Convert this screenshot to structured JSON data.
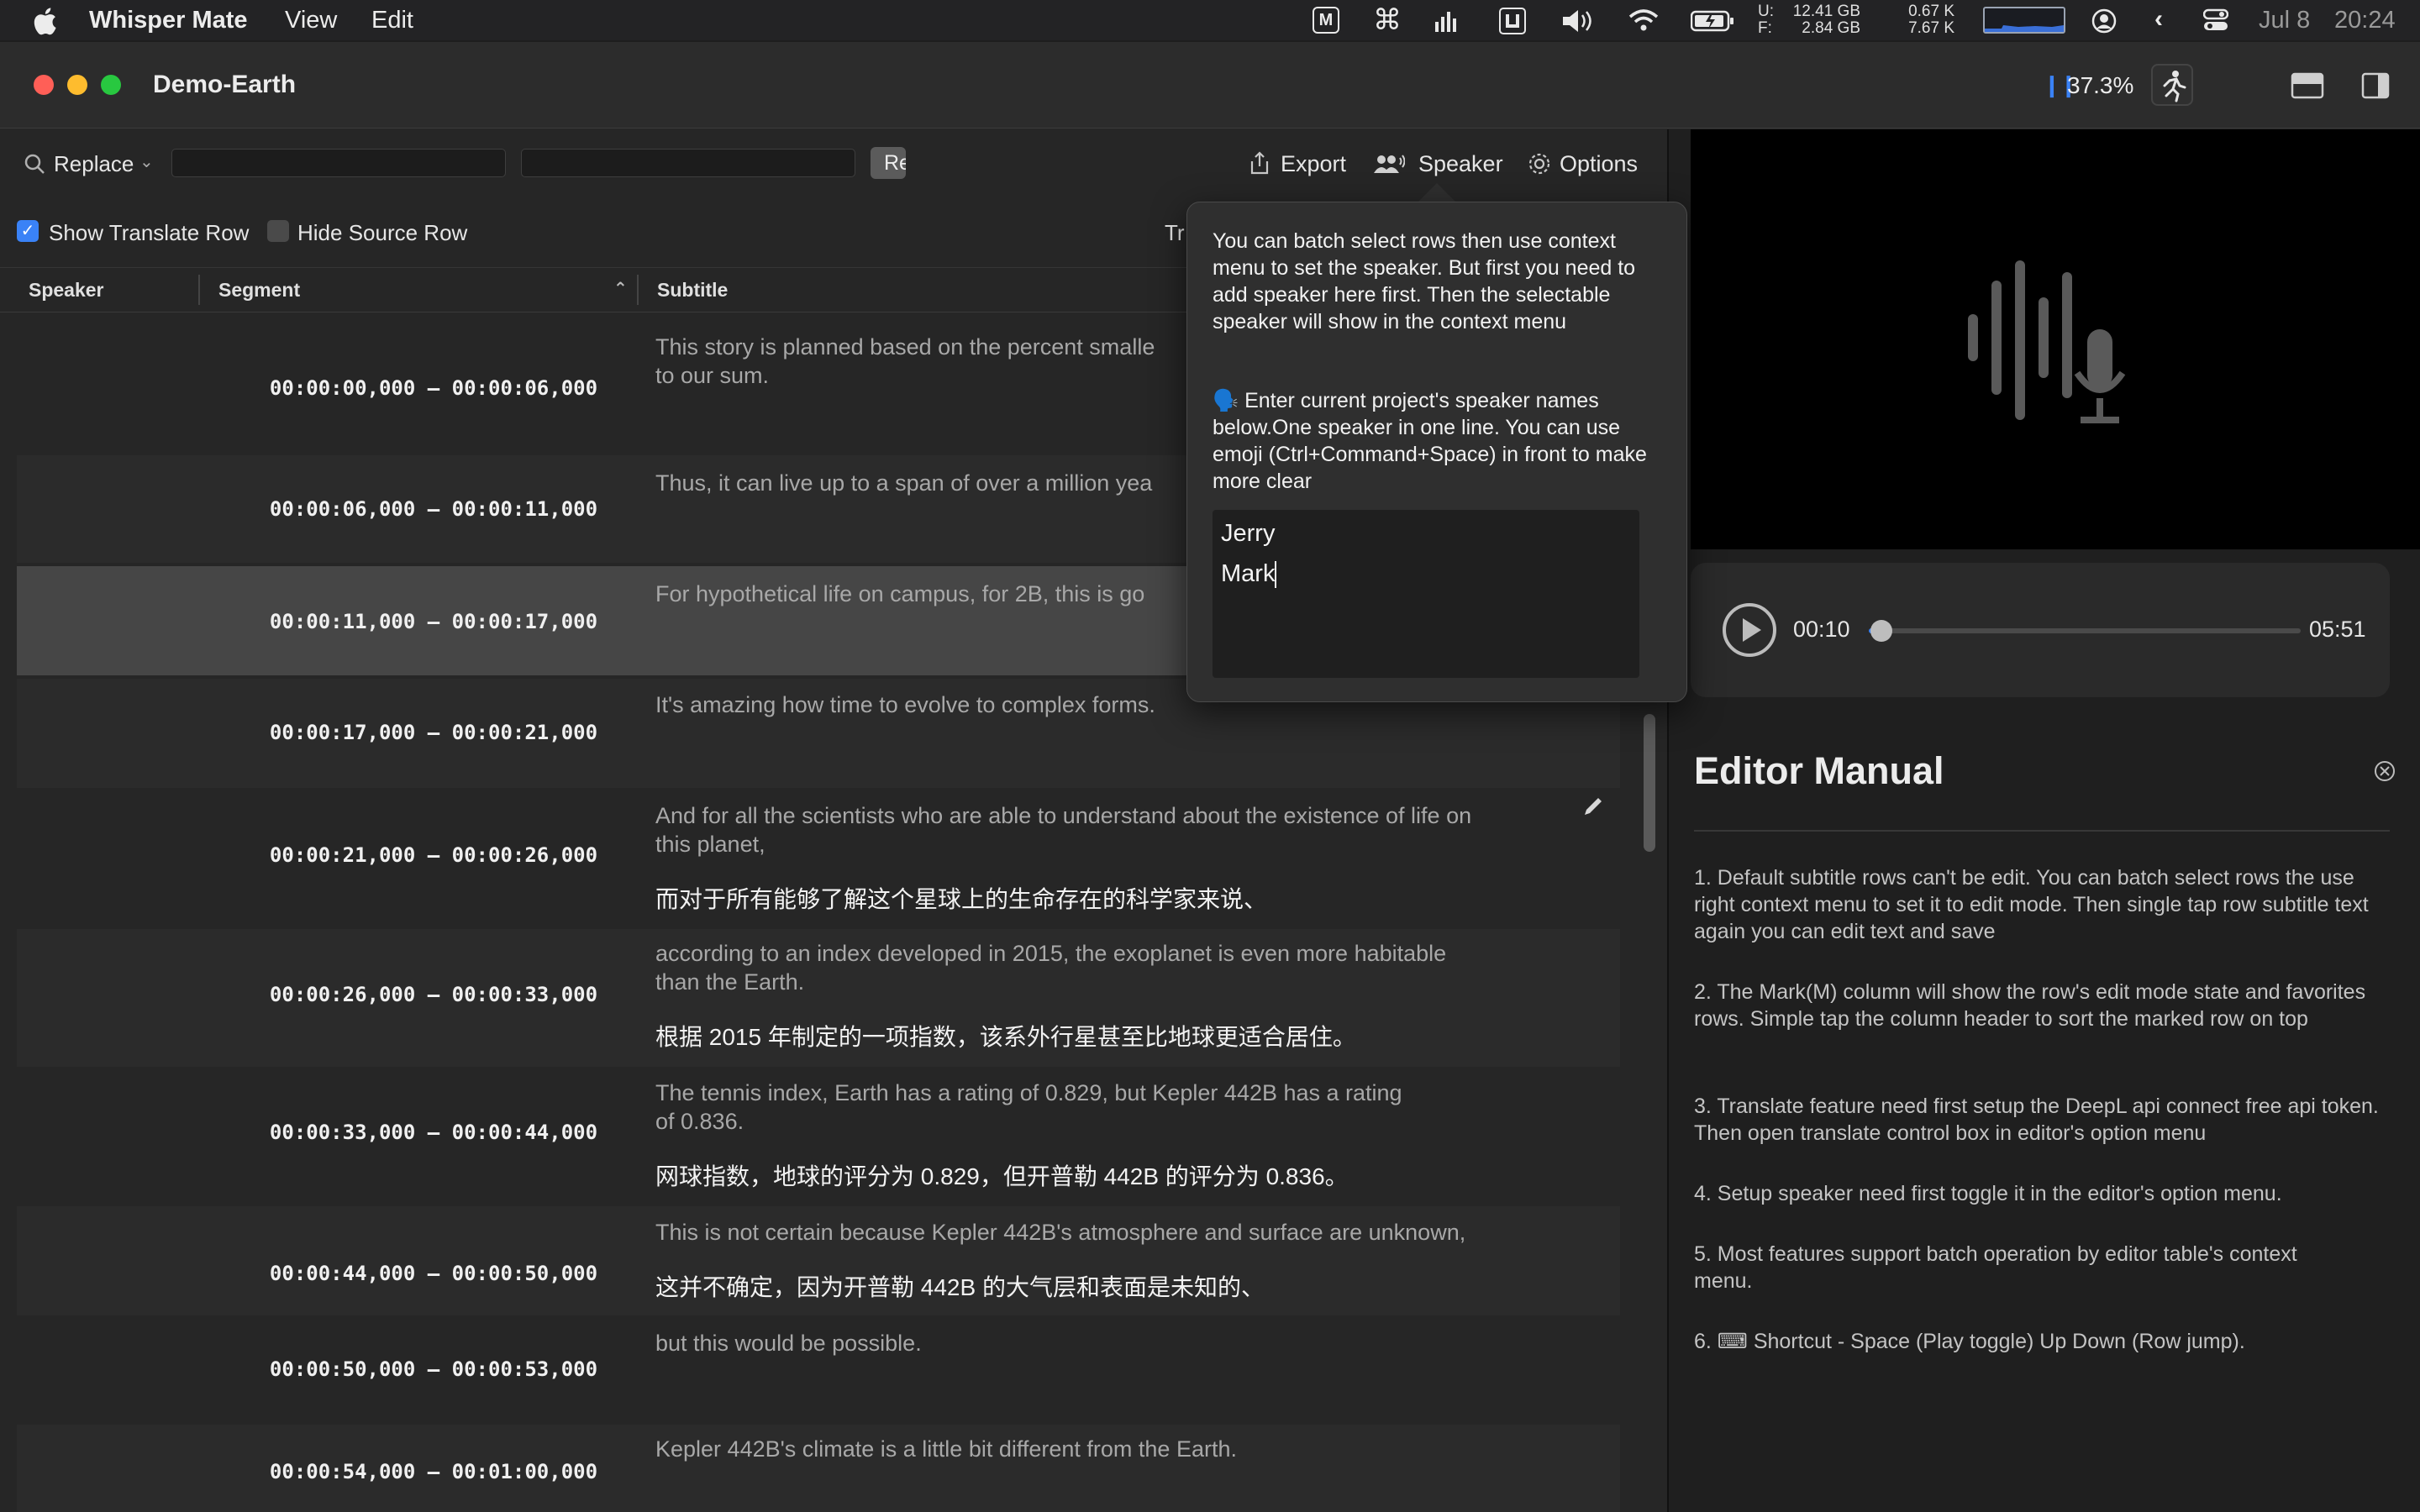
{
  "menubar": {
    "app_name": "Whisper Mate",
    "menus": [
      "View",
      "Edit"
    ],
    "tray": {
      "disk_u_label": "U:",
      "disk_u": "12.41 GB",
      "disk_f_label": "F:",
      "disk_f": "2.84 GB",
      "net_up": "0.67 K",
      "net_down": "7.67 K",
      "date": "Jul 8",
      "time": "20:24"
    }
  },
  "window": {
    "title": "Demo-Earth",
    "progress": "37.3%"
  },
  "toolbar": {
    "replace_label": "Replace",
    "find_value": "",
    "replace_value": "",
    "replace_button": "Re",
    "export_label": "Export",
    "speaker_label": "Speaker",
    "options_label": "Options"
  },
  "options_row": {
    "show_translate_label": "Show Translate Row",
    "show_translate_checked": true,
    "hide_source_label": "Hide Source Row",
    "hide_source_checked": false,
    "partial_label": "Tr"
  },
  "table": {
    "headers": {
      "speaker": "Speaker",
      "segment": "Segment",
      "subtitle": "Subtitle"
    },
    "rows": [
      {
        "segment": "00:00:00,000 – 00:00:06,000",
        "source": "This story is planned based on the percent smalle",
        "source2": "to our sum.",
        "translation": ""
      },
      {
        "segment": "00:00:06,000 – 00:00:11,000",
        "source": "Thus, it can live up to a span of over a million yea",
        "source2": "",
        "translation": ""
      },
      {
        "segment": "00:00:11,000 – 00:00:17,000",
        "source": "For hypothetical life on campus, for 2B, this is go",
        "source2": "",
        "translation": ""
      },
      {
        "segment": "00:00:17,000 – 00:00:21,000",
        "source": "It's amazing how time to evolve to complex forms.",
        "source2": "",
        "translation": ""
      },
      {
        "segment": "00:00:21,000 – 00:00:26,000",
        "source": "And for all the scientists who are able to understand about the existence of life on",
        "source2": "this planet,",
        "translation": "而对于所有能够了解这个星球上的生命存在的科学家来说、"
      },
      {
        "segment": "00:00:26,000 – 00:00:33,000",
        "source": "according to an index developed in 2015, the exoplanet is even more habitable",
        "source2": "than the Earth.",
        "translation": "根据 2015 年制定的一项指数，该系外行星甚至比地球更适合居住。"
      },
      {
        "segment": "00:00:33,000 – 00:00:44,000",
        "source": "The tennis index, Earth has a rating of 0.829, but Kepler 442B has a rating",
        "source2": "of 0.836.",
        "translation": "网球指数，地球的评分为 0.829，但开普勒 442B 的评分为 0.836。"
      },
      {
        "segment": "00:00:44,000 – 00:00:50,000",
        "source": "This is not certain because Kepler 442B's atmosphere and surface are unknown,",
        "source2": "",
        "translation": "这并不确定，因为开普勒 442B 的大气层和表面是未知的、"
      },
      {
        "segment": "00:00:50,000 – 00:00:53,000",
        "source": "but this would be possible.",
        "source2": "",
        "translation": ""
      },
      {
        "segment": "00:00:54,000 – 00:01:00,000",
        "source": "Kepler 442B's climate is a little bit different from the Earth.",
        "source2": "",
        "translation": ""
      }
    ]
  },
  "popover": {
    "para1": "You can batch select rows then use context menu to set the speaker. But first you need to add speaker here first. Then the selectable speaker will show in the context menu",
    "para2": "🗣️ Enter current project's speaker names below.One speaker in one line. You can use emoji (Ctrl+Command+Space) in front to make more clear",
    "speakers": [
      "Jerry",
      "Mark"
    ]
  },
  "player": {
    "current_time": "00:10",
    "total_time": "05:51",
    "progress": 0.03
  },
  "manual": {
    "title": "Editor Manual",
    "items": [
      "1. Default subtitle rows can't be edit. You can batch select rows the use right context menu to set it to edit mode. Then single tap row subtitle text again you can edit text and save",
      "2. The Mark(M) column will show the row's edit mode state and favorites rows. Simple tap the column header to sort the marked row on top",
      "3. Translate feature need first setup the DeepL api connect free api token. Then open translate control box in editor's option menu",
      "4. Setup speaker need first toggle it in the editor's option menu.",
      "5. Most features support batch operation by editor table's context menu.",
      "6. ⌨ Shortcut - Space (Play toggle) Up Down (Row jump)."
    ]
  },
  "colors": {
    "accent": "#3a82f6",
    "close": "#ff5f57",
    "minimize": "#febc2e",
    "zoom": "#28c840"
  }
}
